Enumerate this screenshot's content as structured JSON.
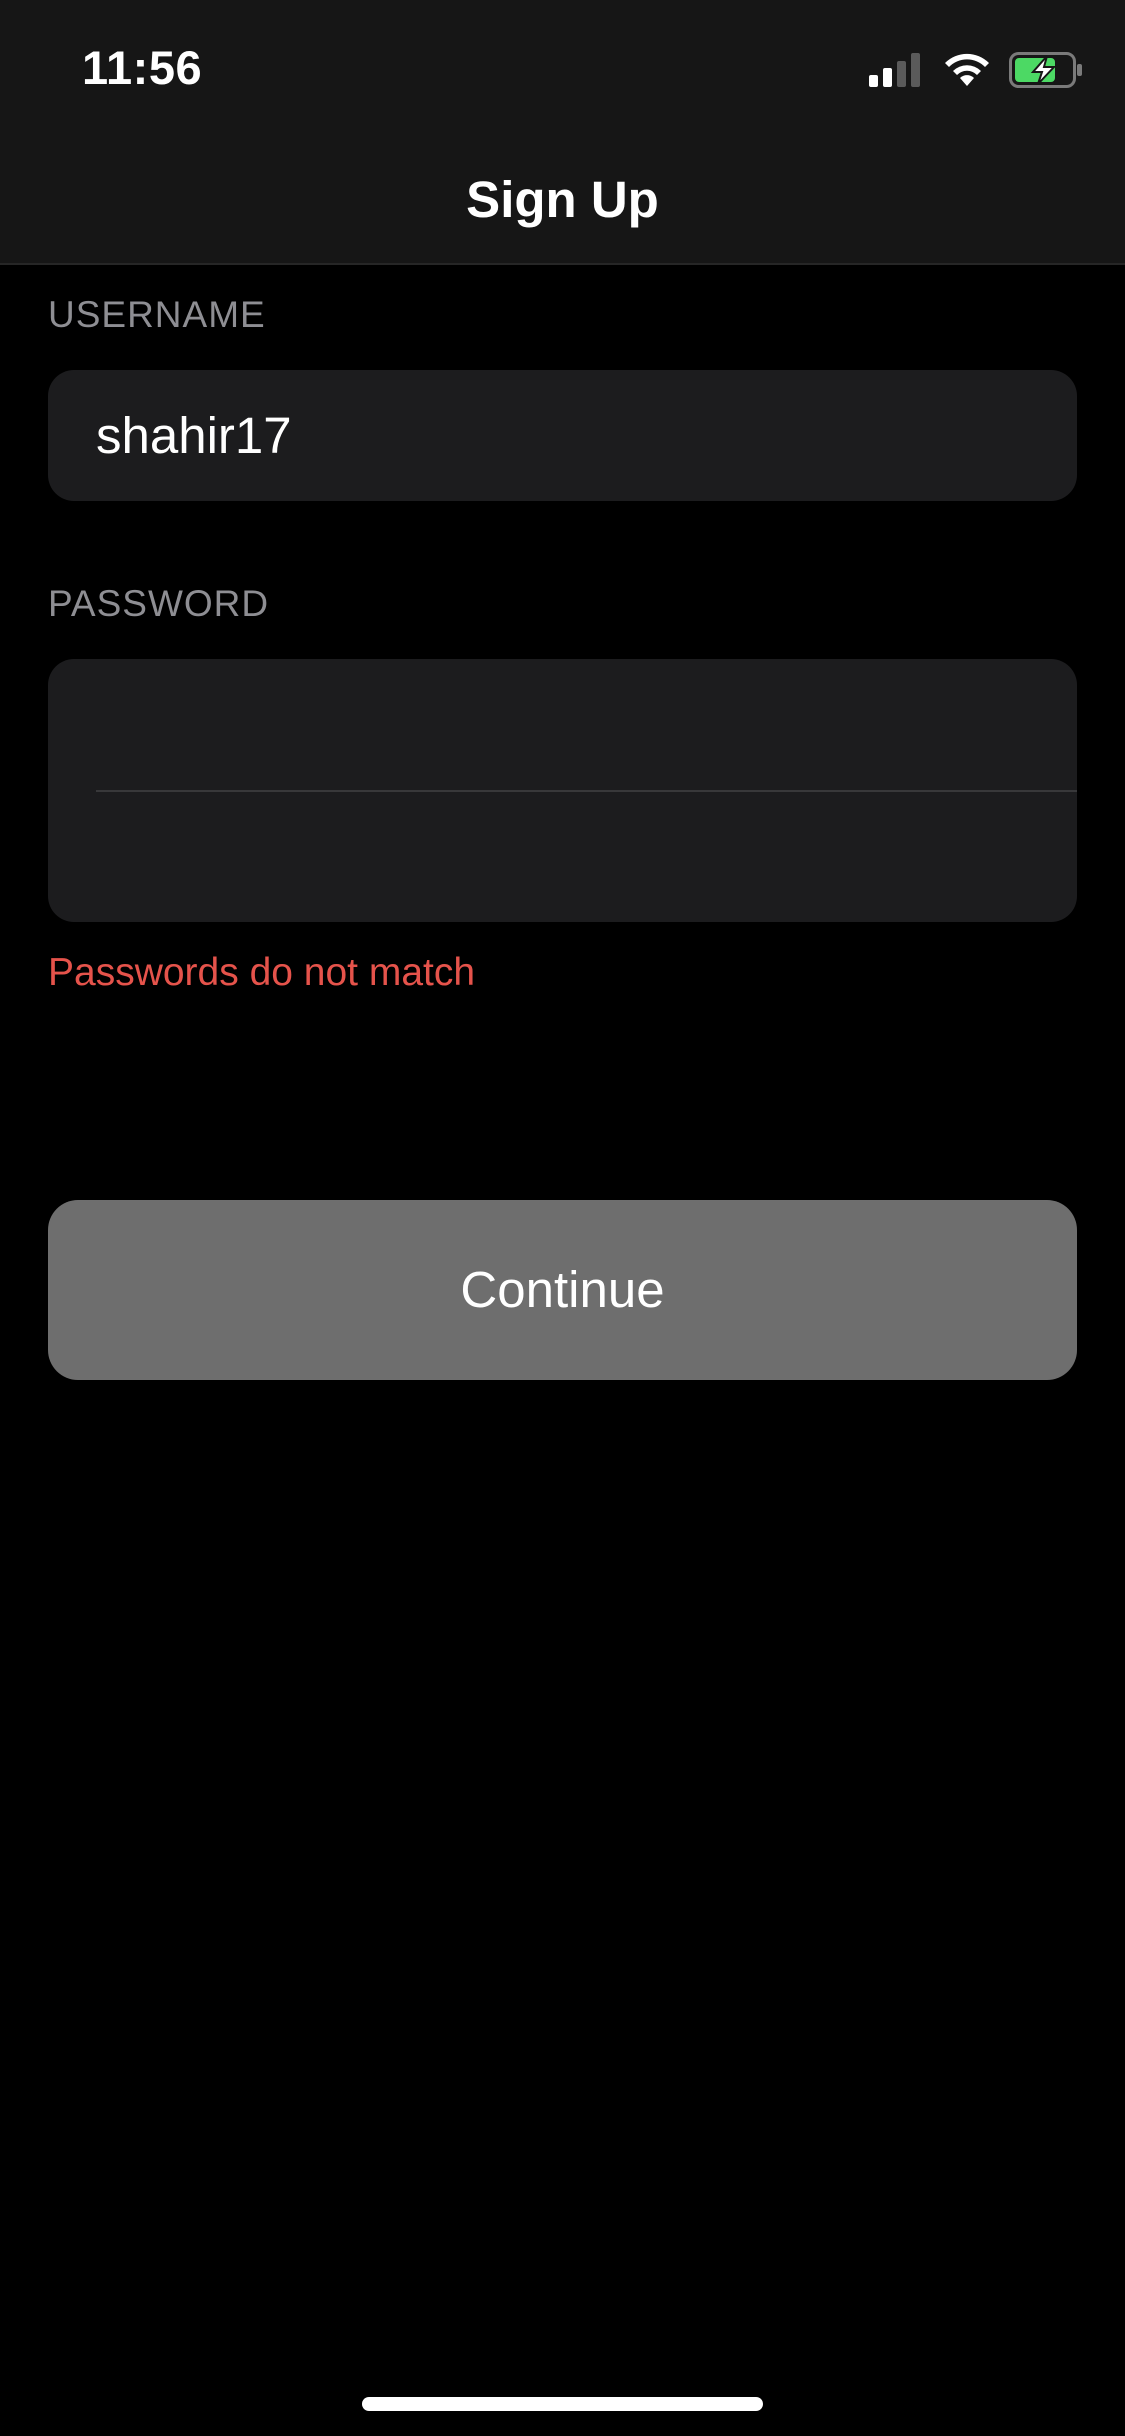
{
  "status_bar": {
    "time": "11:56",
    "icons": [
      "cellular-signal-icon",
      "wifi-icon",
      "battery-charging-icon"
    ],
    "battery_color": "#4cd964"
  },
  "nav": {
    "title": "Sign Up"
  },
  "form": {
    "username_label": "USERNAME",
    "username_value": "shahir17",
    "password_label": "PASSWORD",
    "password_value": "",
    "confirm_password_value": "",
    "error_message": "Passwords do not match",
    "error_color": "#e5534b"
  },
  "actions": {
    "continue_label": "Continue"
  }
}
